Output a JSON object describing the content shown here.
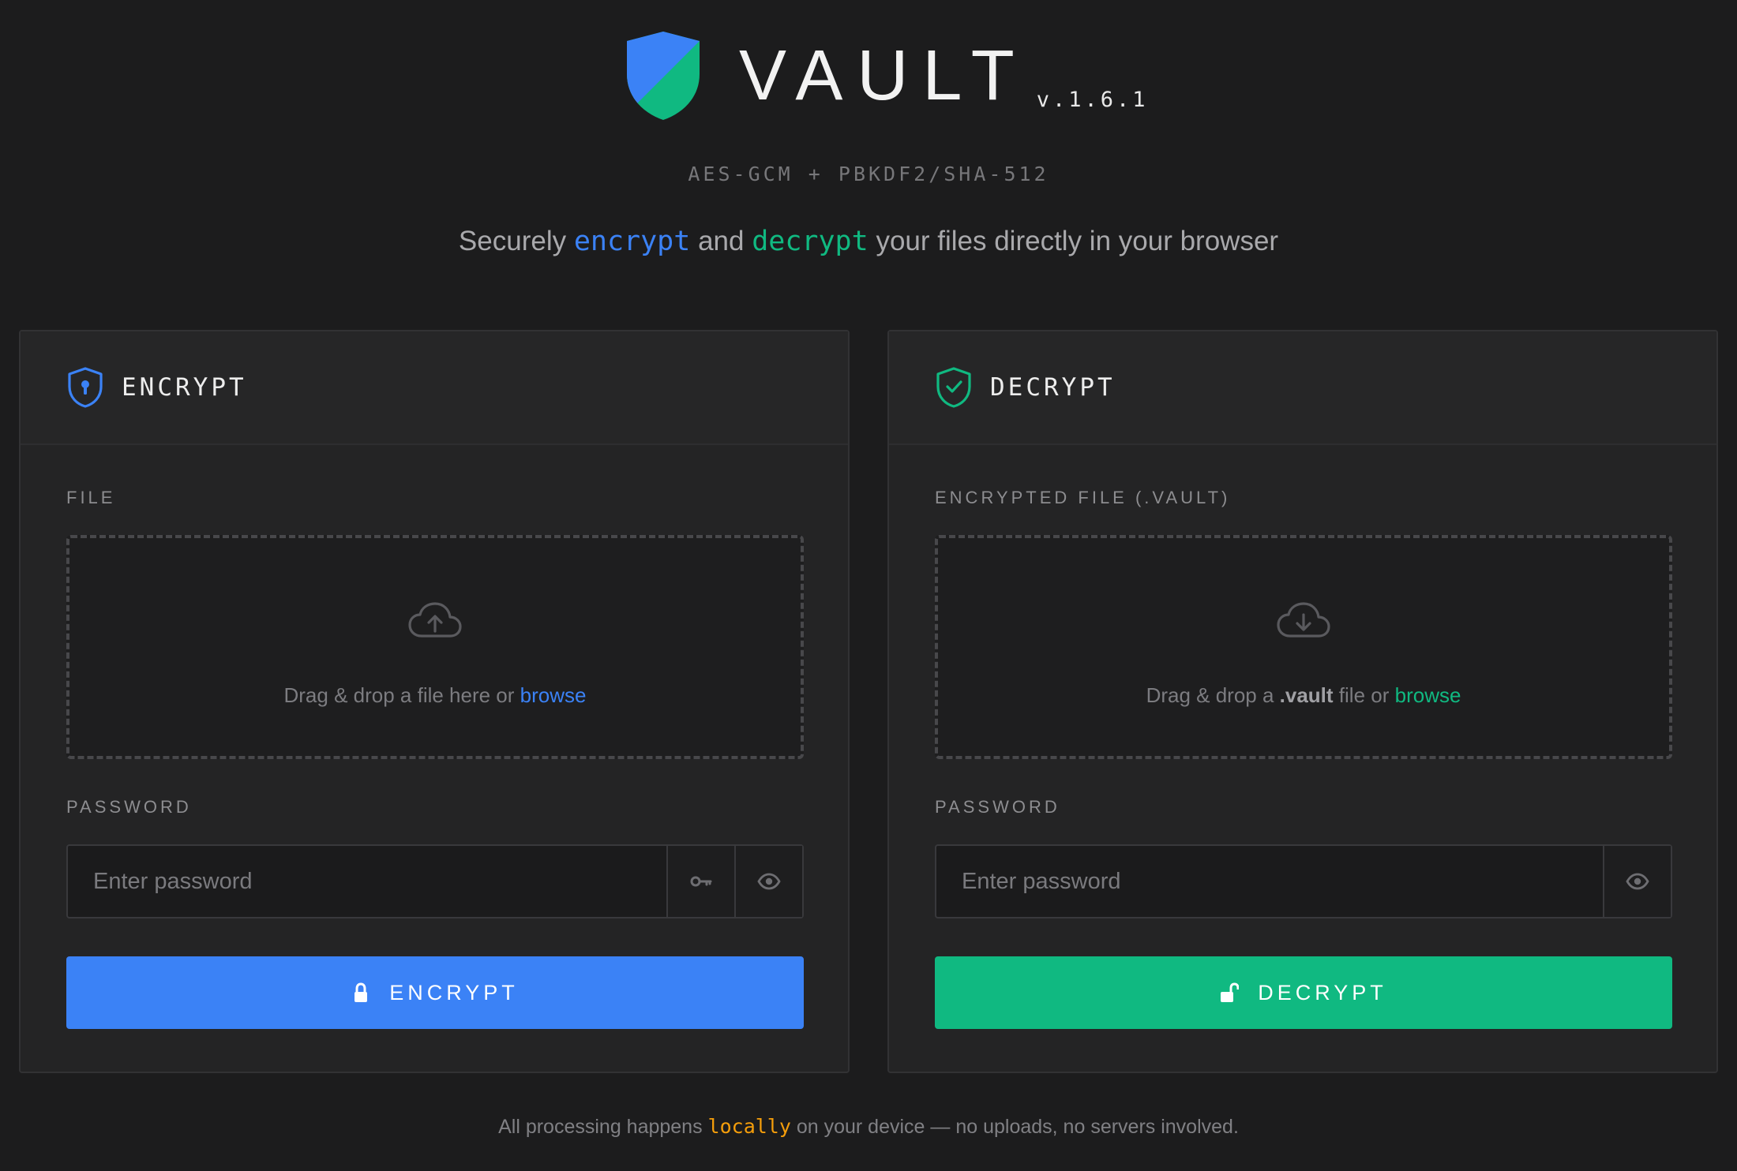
{
  "brand": {
    "title": "VAULT",
    "version": "v.1.6.1",
    "algo": "AES-GCM + PBKDF2/SHA-512",
    "tagline_pre": "Securely ",
    "tagline_encrypt": "encrypt",
    "tagline_mid": " and ",
    "tagline_decrypt": "decrypt",
    "tagline_post": " your files directly in your browser"
  },
  "colors": {
    "background": "#1c1c1d",
    "panel": "#242425",
    "encrypt_accent": "#3b82f6",
    "decrypt_accent": "#10b981",
    "local_accent": "#f59e0b"
  },
  "encrypt": {
    "title": "ENCRYPT",
    "icon": "shield-keyhole-icon",
    "file_label": "FILE",
    "drop_text": "Drag & drop a file here or ",
    "drop_link": "browse",
    "drop_icon": "cloud-upload-icon",
    "password_label": "PASSWORD",
    "password_placeholder": "Enter password",
    "password_value": "",
    "generate_icon": "key-icon",
    "toggle_icon": "eye-icon",
    "action_label": "ENCRYPT",
    "action_icon": "lock-icon"
  },
  "decrypt": {
    "title": "DECRYPT",
    "icon": "shield-check-icon",
    "file_label": "ENCRYPTED FILE (.VAULT)",
    "drop_text_pre": "Drag & drop a ",
    "drop_text_ext": ".vault",
    "drop_text_post": " file or ",
    "drop_link": "browse",
    "drop_icon": "cloud-download-icon",
    "password_label": "PASSWORD",
    "password_placeholder": "Enter password",
    "password_value": "",
    "toggle_icon": "eye-icon",
    "action_label": "DECRYPT",
    "action_icon": "unlock-icon"
  },
  "footer": {
    "pre": "All processing happens ",
    "highlight": "locally",
    "post": " on your device — no uploads, no servers involved."
  }
}
